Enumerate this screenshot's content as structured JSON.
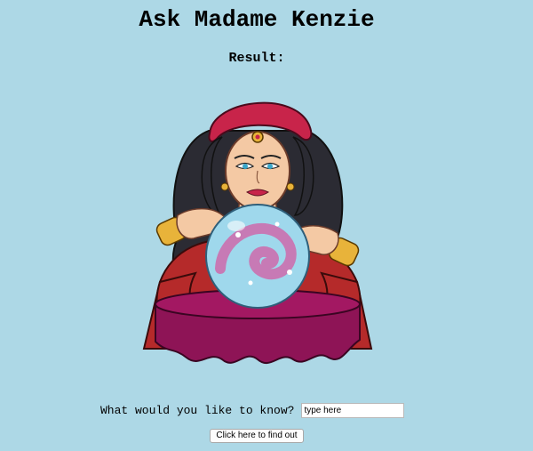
{
  "page": {
    "title": "Ask Madame Kenzie",
    "result_label": "Result:",
    "question_label": "What would you like to know?",
    "question_placeholder": "type here",
    "question_value": "",
    "submit_label": "Click here to find out"
  },
  "colors": {
    "background": "#add8e6",
    "scarf": "#c8244a",
    "hair": "#2b2b33",
    "skin": "#f4c9a4",
    "crystal_ball": "#9fd8ec",
    "swirl": "#c77ab5",
    "tablecloth": "#8e1456",
    "dress": "#b52a2a",
    "gold": "#e8b33a"
  },
  "illustration": {
    "subject": "fortune-teller-with-crystal-ball"
  }
}
